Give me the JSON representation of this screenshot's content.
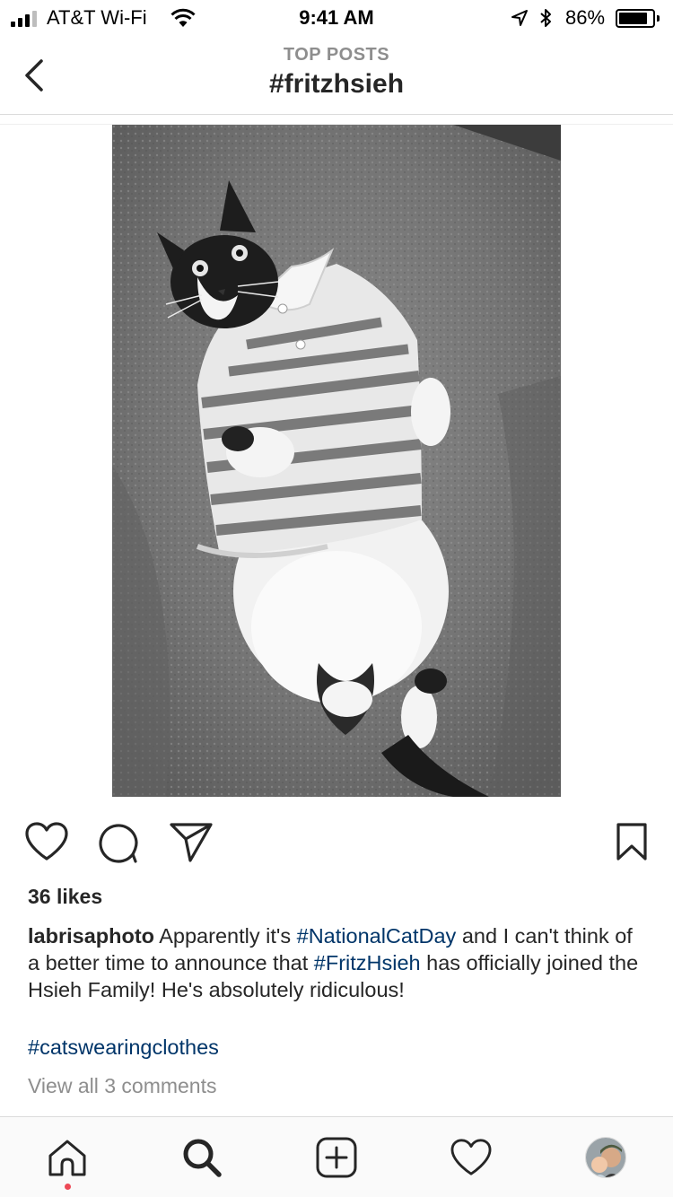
{
  "status_bar": {
    "carrier": "AT&T Wi-Fi",
    "time": "9:41 AM",
    "battery_percent": "86%",
    "battery_level": 0.86,
    "signal_bars_active": 3,
    "signal_bars_total": 4,
    "icons": [
      "signal-icon",
      "wifi-icon",
      "location-icon",
      "bluetooth-icon",
      "battery-icon"
    ]
  },
  "header": {
    "subtitle": "TOP POSTS",
    "title": "#fritzhsieh",
    "back_icon": "chevron-left-icon"
  },
  "post": {
    "image_description_icon": "photo",
    "actions": {
      "like_icon": "heart-outline-icon",
      "comment_icon": "comment-bubble-icon",
      "share_icon": "paper-plane-icon",
      "save_icon": "bookmark-icon"
    },
    "likes": "36 likes",
    "caption": {
      "username": "labrisaphoto",
      "part1": " Apparently it's ",
      "tag1": "#NationalCatDay",
      "part2": " and I can't think of a better time to announce that ",
      "tag2": "#FritzHsieh",
      "part3": " has officially joined the Hsieh Family! He's absolutely ridiculous!",
      "tag3": "#catswearingclothes"
    },
    "view_comments": "View all 3 comments"
  },
  "tab_bar": {
    "items": [
      "home-icon",
      "search-icon",
      "new-post-icon",
      "activity-heart-icon",
      "profile-avatar"
    ],
    "active": "home",
    "notification_dot_color": "#ed4956"
  },
  "colors": {
    "hashtag": "#003569",
    "secondary_text": "#8e8e8e",
    "divider": "#dbdbdb"
  }
}
